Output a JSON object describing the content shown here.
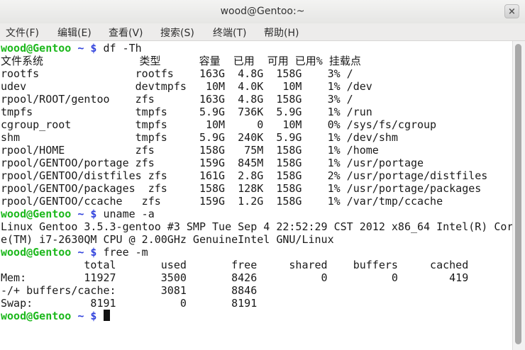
{
  "window": {
    "title": "wood@Gentoo:~",
    "close_label": "×"
  },
  "menubar": {
    "items": [
      "文件(F)",
      "编辑(E)",
      "查看(V)",
      "搜索(S)",
      "终端(T)",
      "帮助(H)"
    ]
  },
  "terminal": {
    "prompt": {
      "user": "wood@Gentoo",
      "path": "~",
      "symbol": "$"
    },
    "lines": [
      {
        "type": "prompt",
        "cmd": "df -Th"
      },
      {
        "type": "out",
        "text": "文件系统               类型      容量  已用  可用 已用% 挂载点"
      },
      {
        "type": "out",
        "text": "rootfs               rootfs    163G  4.8G  158G    3% /"
      },
      {
        "type": "out",
        "text": "udev                 devtmpfs   10M  4.0K   10M    1% /dev"
      },
      {
        "type": "out",
        "text": "rpool/ROOT/gentoo    zfs       163G  4.8G  158G    3% /"
      },
      {
        "type": "out",
        "text": "tmpfs                tmpfs     5.9G  736K  5.9G    1% /run"
      },
      {
        "type": "out",
        "text": "cgroup_root          tmpfs      10M     0   10M    0% /sys/fs/cgroup"
      },
      {
        "type": "out",
        "text": "shm                  tmpfs     5.9G  240K  5.9G    1% /dev/shm"
      },
      {
        "type": "out",
        "text": "rpool/HOME           zfs       158G   75M  158G    1% /home"
      },
      {
        "type": "out",
        "text": "rpool/GENTOO/portage zfs       159G  845M  158G    1% /usr/portage"
      },
      {
        "type": "out",
        "text": "rpool/GENTOO/distfiles zfs     161G  2.8G  158G    2% /usr/portage/distfiles"
      },
      {
        "type": "out",
        "text": "rpool/GENTOO/packages  zfs     158G  128K  158G    1% /usr/portage/packages"
      },
      {
        "type": "out",
        "text": "rpool/GENTOO/ccache   zfs      159G  1.2G  158G    1% /var/tmp/ccache"
      },
      {
        "type": "prompt",
        "cmd": "uname -a"
      },
      {
        "type": "out",
        "text": "Linux Gentoo 3.5.3-gentoo #3 SMP Tue Sep 4 22:52:29 CST 2012 x86_64 Intel(R) Cor"
      },
      {
        "type": "out",
        "text": "e(TM) i7-2630QM CPU @ 2.00GHz GenuineIntel GNU/Linux"
      },
      {
        "type": "prompt",
        "cmd": "free -m"
      },
      {
        "type": "out",
        "text": "             total       used       free     shared    buffers     cached"
      },
      {
        "type": "out",
        "text": "Mem:         11927       3500       8426          0          0        419"
      },
      {
        "type": "out",
        "text": "-/+ buffers/cache:       3081       8846"
      },
      {
        "type": "out",
        "text": "Swap:         8191          0       8191"
      },
      {
        "type": "prompt",
        "cmd": "",
        "cursor": true
      }
    ]
  }
}
